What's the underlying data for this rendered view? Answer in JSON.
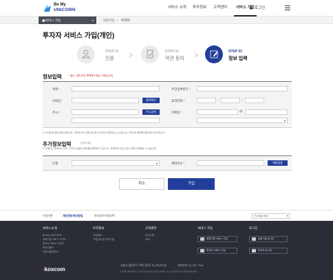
{
  "header": {
    "logo_line1": "Be My",
    "logo_line2": "UNICORN",
    "nav": [
      "서비스 소개",
      "투자정보",
      "고객센터",
      "서비스 가입"
    ],
    "login": "로그인"
  },
  "breadcrumb": {
    "section": "서비스 가입",
    "items": [
      "회원가입",
      "투자자"
    ]
  },
  "page_title": "투자자 서비스 가입(개인)",
  "steps": [
    {
      "label": "STEP 01",
      "name": "인증"
    },
    {
      "label": "STEP 02",
      "name": "약관 동의"
    },
    {
      "label": "STEP 03",
      "name": "정보 입력"
    }
  ],
  "section1": {
    "title": "정보입력",
    "note": "* 필수 사항 (모든 항목에서 필수 사항입니다)",
    "fields": {
      "name": "성명",
      "nickname": "닉네임",
      "address": "주소",
      "rrn": "주민등록번호",
      "phone": "휴대전화",
      "email": "이메일"
    },
    "dup_check": "중복확인",
    "addr_search": "주소검색",
    "email_at": "@",
    "dash": "-",
    "footnote": "※ 닉네임은 필수입력사항으로 기본적으로 성명으로 표시되지만 변경하실 수 있습니다. 변경 후 중복확인을 해주셔야 합니다."
  },
  "section2": {
    "title": "추가정보입력",
    "note": "(선택사항)",
    "footnote": "※ 은행 및 계좌번호 입력 시 투자 입출금 계좌를 등록하여 주십시오. 등록하지 않은 경우 이용이 제한될 수 있습니다.",
    "bank": "은행",
    "account": "계좌번호",
    "verify": "계좌검증"
  },
  "buttons": {
    "cancel": "취소",
    "join": "가입"
  },
  "footer": {
    "links": [
      "이용약관",
      "개인정보처리방침",
      "위치정보이용정책"
    ],
    "family_site": "Family Site",
    "cols": [
      {
        "title": "서비스소개",
        "items": [
          "Be My UNICORN",
          "등록기업 서비스 가이드",
          "투자자 서비스 가이드",
          "보안인증서",
          "인증서발급안내"
        ]
      },
      {
        "title": "투자정보",
        "items": [
          "기업정보",
          "기업실적 및 투자기업"
        ]
      },
      {
        "title": "고객센터",
        "items": [
          "공지사항",
          "FAQ"
        ]
      }
    ],
    "join_title": "서비스 가입",
    "join_btns": [
      "등록기업 서비스 가입",
      "투자자 서비스 가입"
    ],
    "login_title": "로그인",
    "login_btns": [
      "등록기업 로그인",
      "투자자 로그인"
    ],
    "brand": "koscom",
    "address": "서울시 영등포구 여의나루로 76 (주)코스콤",
    "tel": "대표전화: 02-767-7114",
    "copyright": "COPYRIGHT © 2019 KOSCOM CORP. ALL RIGHTS RESERVED."
  }
}
